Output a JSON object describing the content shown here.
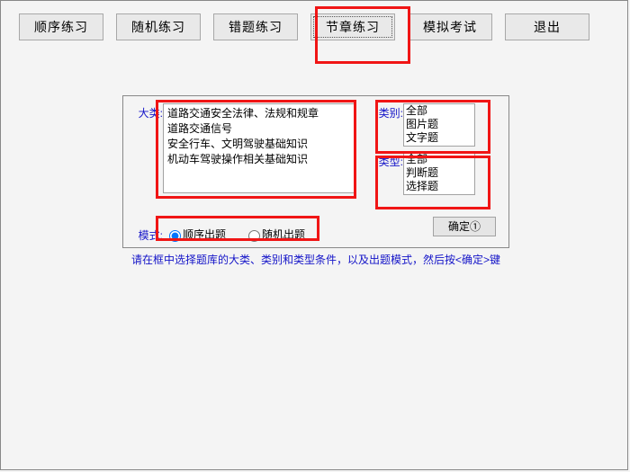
{
  "toolbar": {
    "buttons": [
      {
        "label": "顺序练习"
      },
      {
        "label": "随机练习"
      },
      {
        "label": "错题练习"
      },
      {
        "label": "节章练习"
      },
      {
        "label": "模拟考试"
      },
      {
        "label": "退出"
      }
    ],
    "active_index": 3
  },
  "panel": {
    "labels": {
      "category_major": "大类:",
      "category_minor": "类别:",
      "type": "类型:",
      "mode": "模式:"
    },
    "major_items": [
      "道路交通安全法律、法规和规章",
      "道路交通信号",
      "安全行车、文明驾驶基础知识",
      "机动车驾驶操作相关基础知识"
    ],
    "minor_items": [
      "全部",
      "图片题",
      "文字题"
    ],
    "type_items": [
      "全部",
      "判断题",
      "选择题"
    ],
    "mode_options": {
      "sequential": "顺序出题",
      "random": "随机出题"
    },
    "ok_button": "确定①"
  },
  "hint_text": "请在框中选择题库的大类、类别和类型条件，以及出题模式，然后按<确定>键"
}
